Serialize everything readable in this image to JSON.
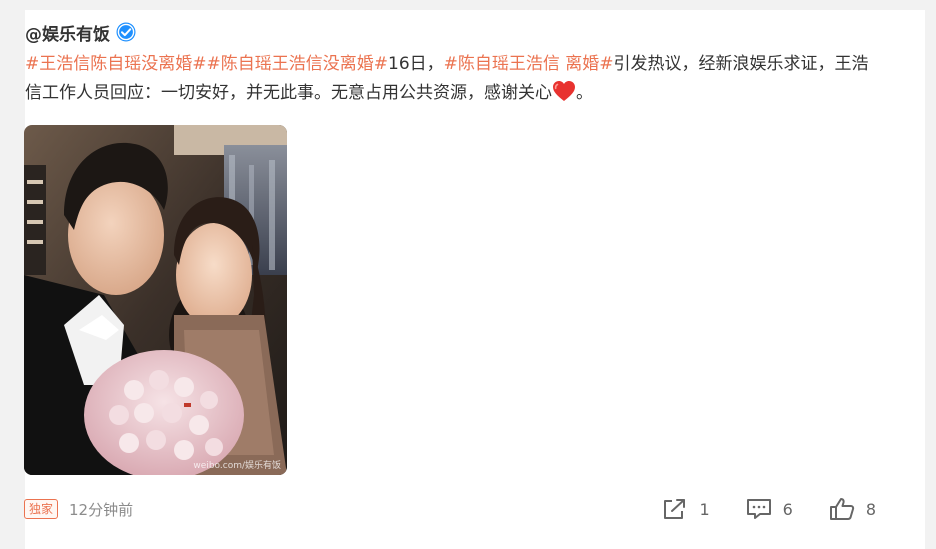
{
  "post": {
    "author": "@娱乐有饭",
    "content": [
      {
        "type": "topic",
        "text": "#王浩信陈自瑶没离婚#"
      },
      {
        "type": "topic",
        "text": "#陈自瑶王浩信没离婚#"
      },
      {
        "type": "text",
        "text": "16日，"
      },
      {
        "type": "topic",
        "text": "#陈自瑶王浩信 离婚#"
      },
      {
        "type": "text",
        "text": "引发热议，经新浪娱乐求证，王浩信工作人员回应：一切安好，并无此事。无意占用公共资源，感谢关心"
      },
      {
        "type": "emoji",
        "text": "heart-emoji"
      },
      {
        "type": "text",
        "text": "。"
      }
    ],
    "image_watermark": "weibo.com/娱乐有饭",
    "badge": "独家",
    "time": "12分钟前",
    "actions": {
      "share_count": "1",
      "comment_count": "6",
      "like_count": "8"
    }
  },
  "icons": {
    "verified": "verified-badge-icon",
    "share": "share-icon",
    "comment": "comment-icon",
    "like": "thumbs-up-icon"
  },
  "colors": {
    "topic": "#eb7350",
    "verified": "#1e90ff",
    "heart": "#e8322f",
    "icon": "#666666"
  }
}
